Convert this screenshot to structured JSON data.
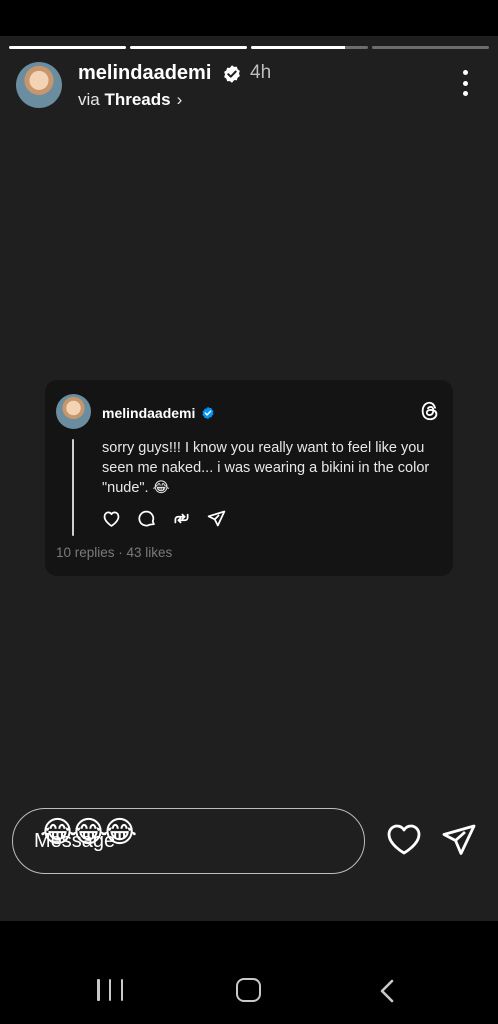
{
  "story": {
    "progress": [
      1,
      1,
      0.8,
      0
    ],
    "username": "melindaademi",
    "time": "4h",
    "via_prefix": "via",
    "via_app": "Threads"
  },
  "post": {
    "username": "melindaademi",
    "text": "sorry guys!!! I know you really want to feel like you seen me naked... i was wearing a bikini in the color \"nude\". 😂",
    "stats": "10 replies · 43 likes"
  },
  "reactions": "😂😂😂",
  "message": {
    "placeholder": "Message"
  },
  "icons": {
    "verified": "verified-badge-icon",
    "more": "more-vertical-icon",
    "threads": "threads-logo-icon",
    "like": "heart-icon",
    "reply": "comment-icon",
    "repost": "repost-icon",
    "share": "send-icon",
    "recent": "recent-apps-icon",
    "home": "home-icon",
    "back": "back-icon"
  },
  "colors": {
    "verified": "#0095f6",
    "background": "#1f1f1f",
    "card": "#141414"
  }
}
